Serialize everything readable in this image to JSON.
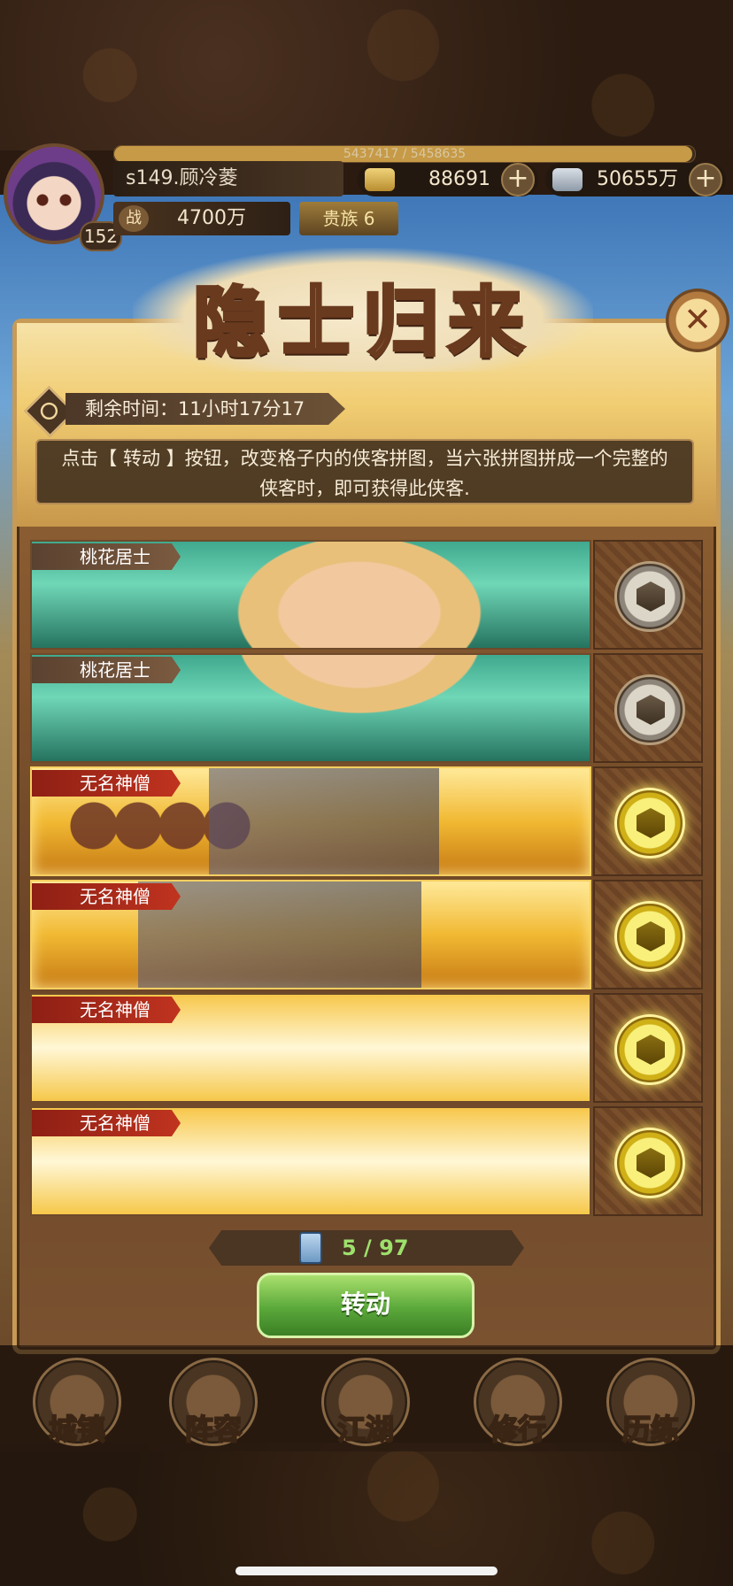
{
  "hud": {
    "exp_text": "5437417 / 5458635",
    "exp_fraction": 0.996,
    "player_name": "s149.顾冷菱",
    "level": "152",
    "gold": "88691",
    "silver": "50655万",
    "power_icon_char": "战",
    "power": "4700万",
    "noble": "贵族 6"
  },
  "event": {
    "title": "隐士归来",
    "timer_label": "剩余时间：11小时17分17秒",
    "description": "点击【 转动 】按钮，改变格子内的侠客拼图，当六张拼图拼成一个完整的侠客时，即可获得此侠客.",
    "close_icon": "close-icon"
  },
  "tiles": [
    {
      "label": "桃花居士",
      "style": "peach",
      "button_active": false
    },
    {
      "label": "桃花居士",
      "style": "peach",
      "button_active": false
    },
    {
      "label": "无名神僧",
      "style": "monk",
      "button_active": true
    },
    {
      "label": "无名神僧",
      "style": "monk",
      "button_active": true
    },
    {
      "label": "无名神僧",
      "style": "glow",
      "button_active": true
    },
    {
      "label": "无名神僧",
      "style": "glow",
      "button_active": true
    }
  ],
  "counter": "5 / 97",
  "spin_button": "转动",
  "nav": [
    {
      "label": "城镇"
    },
    {
      "label": "阵容"
    },
    {
      "label": "江湖"
    },
    {
      "label": "修行"
    },
    {
      "label": "历练"
    }
  ],
  "colors": {
    "accent_gold": "#f1cd72",
    "label_red": "#c0341f",
    "counter_green": "#9ee06c",
    "button_green": "#5aa83a"
  }
}
